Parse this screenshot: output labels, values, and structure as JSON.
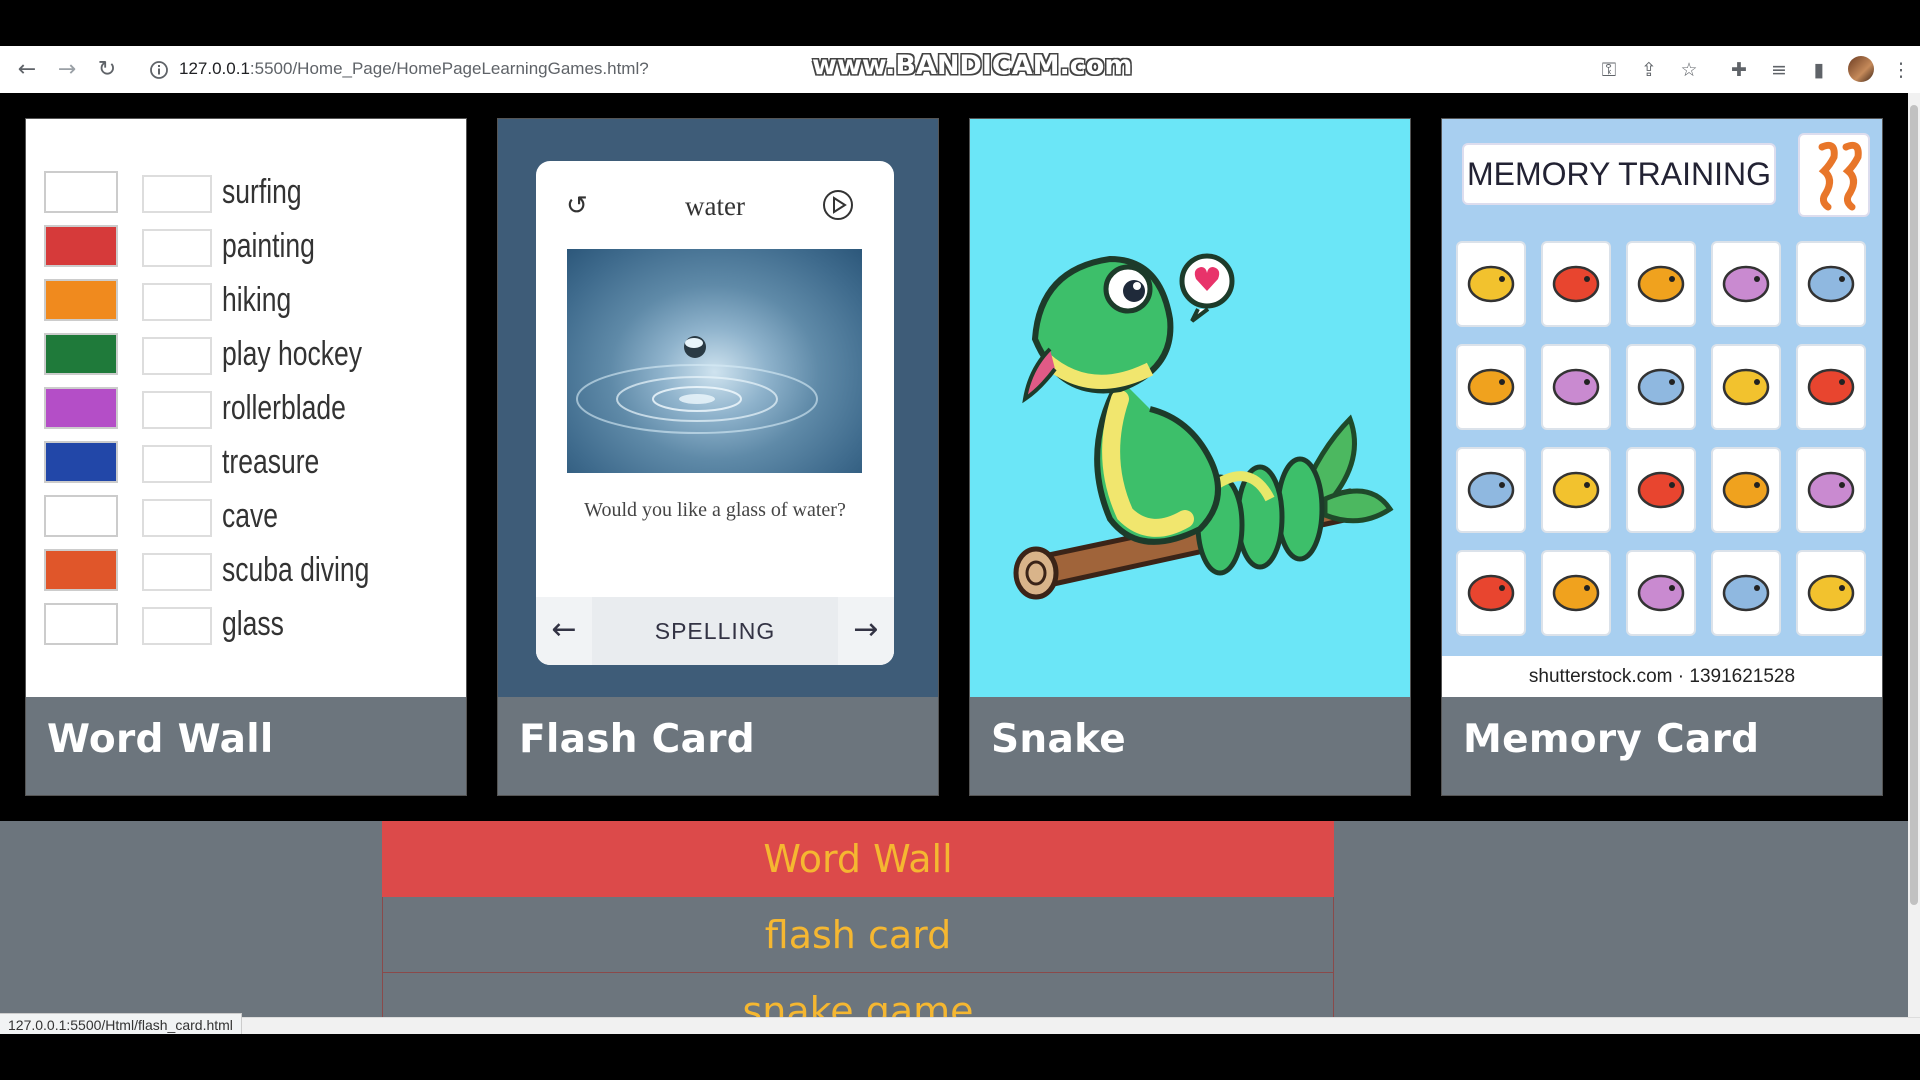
{
  "browser": {
    "url_host": "127.0.0.1",
    "url_rest": ":5500/Home_Page/HomePageLearningGames.html?",
    "watermark": "www.BANDICAM.com",
    "status_url": "127.0.0.1:5500/Html/flash_card.html"
  },
  "cards": [
    {
      "title": "Word Wall"
    },
    {
      "title": "Flash Card"
    },
    {
      "title": "Snake"
    },
    {
      "title": "Memory Card"
    }
  ],
  "word_wall": {
    "words": [
      "surfing",
      "painting",
      "hiking",
      "play hockey",
      "rollerblade",
      "treasure",
      "cave",
      "scuba diving",
      "glass"
    ],
    "thumb_colors": [
      "#ffffff",
      "#d63a3a",
      "#f08a1e",
      "#1f7a3a",
      "#b44ec7",
      "#2247a8",
      "#ffffff",
      "#e0562a",
      "#ffffff"
    ]
  },
  "flash_card": {
    "word": "water",
    "sentence": "Would you like a glass of water?",
    "mode": "SPELLING",
    "prev_icon": "←",
    "next_icon": "→",
    "undo_icon": "↺"
  },
  "memory": {
    "title": "MEMORY TRAINING",
    "credit": "shutterstock.com · 1391621528"
  },
  "menu": {
    "items": [
      "Word Wall",
      "flash card",
      "snake game"
    ]
  }
}
